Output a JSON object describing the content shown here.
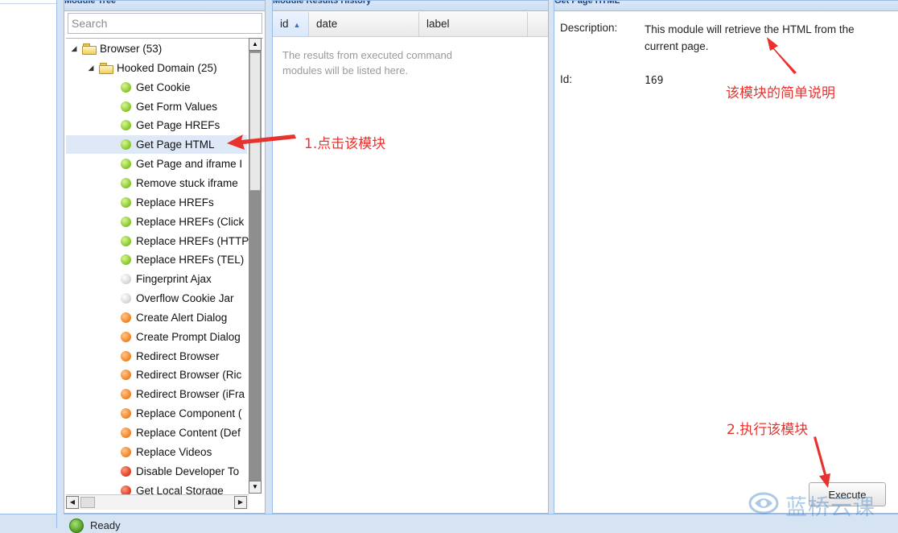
{
  "module_tree": {
    "title": "Module Tree",
    "search_placeholder": "Search",
    "items": [
      {
        "label": "Browser (53)",
        "kind": "folder",
        "level": 0
      },
      {
        "label": "Hooked Domain (25)",
        "kind": "folder",
        "level": 1
      },
      {
        "label": "Get Cookie",
        "kind": "module",
        "status": "green"
      },
      {
        "label": "Get Form Values",
        "kind": "module",
        "status": "green"
      },
      {
        "label": "Get Page HREFs",
        "kind": "module",
        "status": "green"
      },
      {
        "label": "Get Page HTML",
        "kind": "module",
        "status": "green",
        "selected": true
      },
      {
        "label": "Get Page and iframe I",
        "kind": "module",
        "status": "green"
      },
      {
        "label": "Remove stuck iframe",
        "kind": "module",
        "status": "green"
      },
      {
        "label": "Replace HREFs",
        "kind": "module",
        "status": "green"
      },
      {
        "label": "Replace HREFs (Click",
        "kind": "module",
        "status": "green"
      },
      {
        "label": "Replace HREFs (HTTP",
        "kind": "module",
        "status": "green"
      },
      {
        "label": "Replace HREFs (TEL)",
        "kind": "module",
        "status": "green"
      },
      {
        "label": "Fingerprint Ajax",
        "kind": "module",
        "status": "grey"
      },
      {
        "label": "Overflow Cookie Jar",
        "kind": "module",
        "status": "grey"
      },
      {
        "label": "Create Alert Dialog",
        "kind": "module",
        "status": "orange"
      },
      {
        "label": "Create Prompt Dialog",
        "kind": "module",
        "status": "orange"
      },
      {
        "label": "Redirect Browser",
        "kind": "module",
        "status": "orange"
      },
      {
        "label": "Redirect Browser (Ric",
        "kind": "module",
        "status": "orange"
      },
      {
        "label": "Redirect Browser (iFra",
        "kind": "module",
        "status": "orange"
      },
      {
        "label": "Replace Component (",
        "kind": "module",
        "status": "orange"
      },
      {
        "label": "Replace Content (Def",
        "kind": "module",
        "status": "orange"
      },
      {
        "label": "Replace Videos",
        "kind": "module",
        "status": "orange"
      },
      {
        "label": "Disable Developer To",
        "kind": "module",
        "status": "red"
      },
      {
        "label": "Get Local Storage",
        "kind": "module",
        "status": "red"
      }
    ]
  },
  "results": {
    "title": "Module Results History",
    "columns": [
      "id",
      "date",
      "label"
    ],
    "sorted_column": "id",
    "empty_message": "The results from executed command modules will be listed here."
  },
  "detail": {
    "title": "Get Page HTML",
    "description_label": "Description:",
    "description_value": "This module will retrieve the HTML from the current page.",
    "id_label": "Id:",
    "id_value": "169",
    "execute_label": "Execute"
  },
  "status_bar": {
    "text": "Ready"
  },
  "annotations": {
    "step1": "1.点击该模块",
    "module_desc": "该模块的简单说明",
    "step2": "2.执行该模块"
  },
  "watermark": {
    "text": "蓝桥云课"
  },
  "colors": {
    "panel_border": "#99bbe8",
    "background": "#d6e3f2",
    "annotation": "#e8322e",
    "status_green": "#8fcc33",
    "status_grey": "#d9d9d9",
    "status_orange": "#f28a2e",
    "status_red": "#e2452a"
  }
}
